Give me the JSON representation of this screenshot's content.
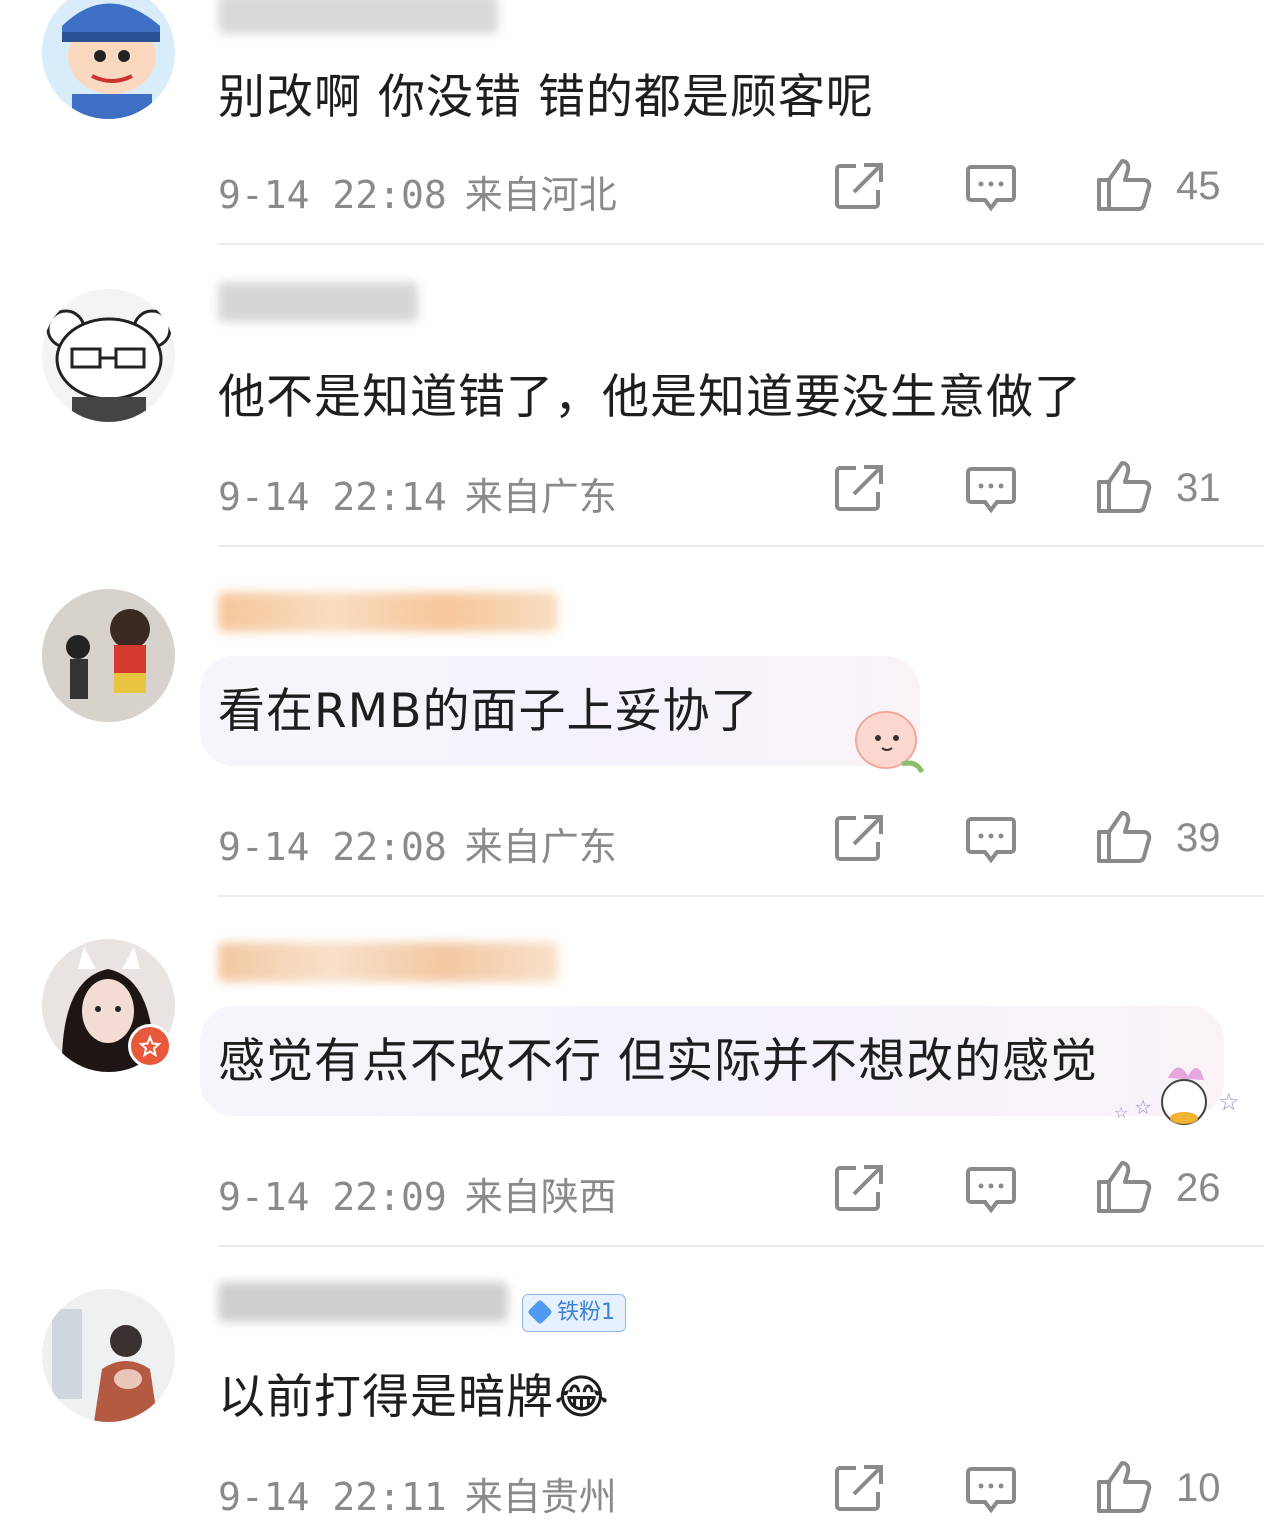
{
  "comments": [
    {
      "text": "别改啊 你没错 错的都是顾客呢",
      "time": "9-14 22:08",
      "location": "来自河北",
      "likes": "45"
    },
    {
      "text": "他不是知道错了，他是知道要没生意做了",
      "time": "9-14 22:14",
      "location": "来自广东",
      "likes": "31"
    },
    {
      "text": "看在RMB的面子上妥协了",
      "time": "9-14 22:08",
      "location": "来自广东",
      "likes": "39"
    },
    {
      "text": "感觉有点不改不行 但实际并不想改的感觉",
      "time": "9-14 22:09",
      "location": "来自陕西",
      "likes": "26"
    },
    {
      "text": "以前打得是暗牌😂",
      "badge": "铁粉1",
      "time": "9-14 22:11",
      "location": "来自贵州",
      "likes": "10"
    }
  ],
  "icons": {
    "share": "share-icon",
    "reply": "comment-icon",
    "like": "thumbs-up-icon"
  },
  "colors": {
    "meta_text": "#8a8a8a",
    "divider": "#ececec",
    "fan_badge": "#3b83d8"
  }
}
